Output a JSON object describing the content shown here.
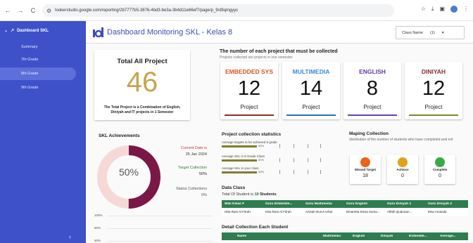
{
  "browser": {
    "url": "lookerstudio.google.com/reporting/2b7777b5-3876-4bd3-be3a-3b4d11e66ef7/page/p_9st9qmgyyc",
    "nav_back": "←",
    "nav_forward": "→",
    "nav_reload": "C"
  },
  "sidebar": {
    "title": "Dashboard SKL",
    "items": [
      {
        "label": "Summary"
      },
      {
        "label": "7th Grade"
      },
      {
        "label": "8th Grade"
      },
      {
        "label": "9th Grade"
      }
    ],
    "collapse": "‹"
  },
  "header": {
    "title": "Dashboard Monitoring SKL - Kelas 8",
    "class_filter_label": "Class Name",
    "class_filter_value": "(1)",
    "colors": {
      "title": "#3b4cc0"
    }
  },
  "total": {
    "title": "Total All Project",
    "value": "46",
    "description": "The Total Project is a Combination of English, Diniyah and IT projects in 1 Semester"
  },
  "projects": {
    "title": "The number of each project that must be collected",
    "subtitle": "Projects collected are projects in one semester",
    "items": [
      {
        "name": "EMBEDDED SYS",
        "value": "12",
        "label": "Project",
        "color": "#d9531e",
        "bar": "#8b2d22"
      },
      {
        "name": "MULTIMEDIA",
        "value": "14",
        "label": "Project",
        "color": "#3b8ad9",
        "bar": "#2f6fb3"
      },
      {
        "name": "ENGLISH",
        "value": "8",
        "label": "Project",
        "color": "#5b3aa6",
        "bar": "#6a3fb5"
      },
      {
        "name": "DINIYAH",
        "value": "12",
        "label": "Project",
        "color": "#8b2b2b",
        "bar": "#7a8a2a"
      }
    ]
  },
  "achievements": {
    "title": "SKL Achievements",
    "percent_label": "50%",
    "percent": 50,
    "current_date_label": "Current Date is",
    "current_date": "25 Jan 2024",
    "target_label": "Target Collection",
    "target_value": "50%",
    "status_label": "Status Collections",
    "status_value": "0%",
    "ring_color": "#7b1747",
    "ring_bg": "#f6d9d6",
    "yticks": [
      "100%",
      "80%",
      "60%"
    ]
  },
  "stats": {
    "title": "Project collection statistics",
    "rows": [
      {
        "label": "Average targets to be achieved 8 grade",
        "pct": "50%"
      },
      {
        "label": "Average SKL in 8 Grade Class",
        "pct": "50%"
      },
      {
        "label": "Average SKL in your class",
        "pct": "50%"
      }
    ]
  },
  "mapping": {
    "title": "Maping Collection",
    "subtitle": "distribution of the number of students who have completed and not",
    "cards": [
      {
        "label": "Missed Target",
        "value": "18",
        "color": "#e8641b"
      },
      {
        "label": "Achiece",
        "value": "0",
        "color": "#e0a21a"
      },
      {
        "label": "Complete",
        "value": "0",
        "color": "#3aa84a"
      }
    ]
  },
  "data_class": {
    "title": "Data Class",
    "subtitle_prefix": "Total Of Student is",
    "student_count": "18",
    "subtitle_suffix": "Students",
    "columns": [
      "Wali Kelas ▾",
      "Guru Embedde...",
      "Guru Multimedia",
      "Guru English",
      "Guru Diniyah 1",
      "Guru Diniyah 2"
    ],
    "rows": [
      [
        "Isha Rani Al Fitrah",
        "Isha Rani Al Fitrah",
        "Anisah Nurul Azhar",
        "Dinaretta Kiesa Suma...",
        "Alfath Qudrotan...",
        "Elsa Amanda"
      ]
    ]
  },
  "detail": {
    "title": "Detail Collection Each Student",
    "columns": [
      "Name",
      "Multimedia",
      "English",
      "Diniyah",
      "Embedde...",
      "Average..."
    ]
  }
}
